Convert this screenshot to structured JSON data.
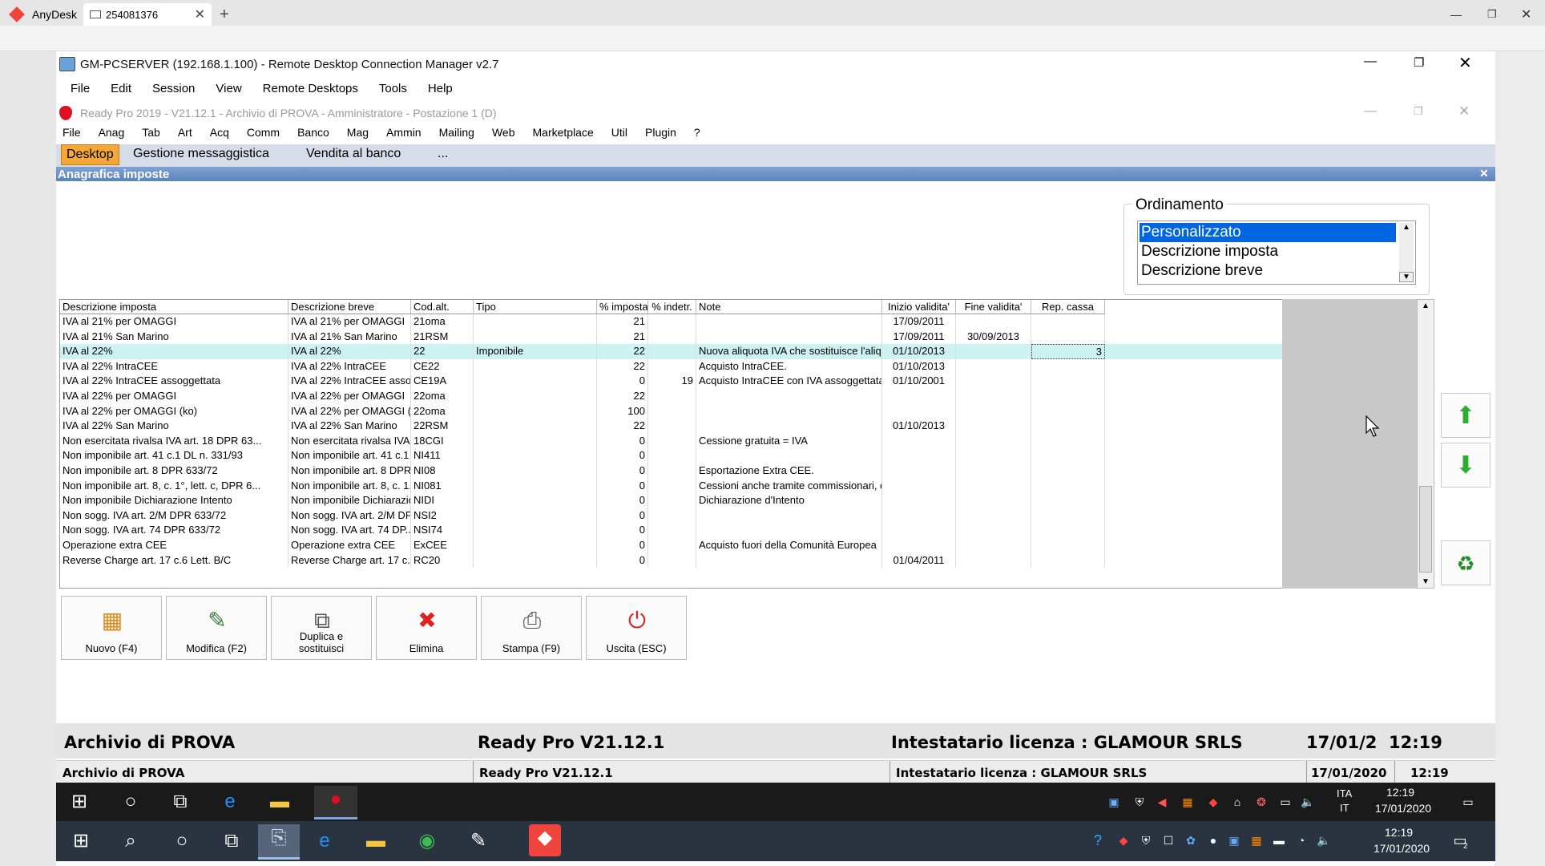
{
  "anydesk": {
    "app_name": "AnyDesk",
    "tab_label": "254081376",
    "address": "254081376",
    "colors": {
      "accent": "#ef443b"
    }
  },
  "rdcm": {
    "title": "GM-PCSERVER (192.168.1.100) - Remote Desktop Connection Manager v2.7",
    "menu": [
      "File",
      "Edit",
      "Session",
      "View",
      "Remote Desktops",
      "Tools",
      "Help"
    ]
  },
  "readypro": {
    "title": "Ready Pro 2019 - V21.12.1 - Archivio di PROVA - Amministratore - Postazione 1 (D)",
    "menu": [
      "File",
      "Anag",
      "Tab",
      "Art",
      "Acq",
      "Comm",
      "Banco",
      "Mag",
      "Ammin",
      "Mailing",
      "Web",
      "Marketplace",
      "Util",
      "Plugin",
      "?"
    ],
    "tabs": [
      "Desktop",
      "Gestione messaggistica",
      "Vendita al banco",
      "..."
    ],
    "panel_title": "Anagrafica imposte"
  },
  "ordinamento": {
    "label": "Ordinamento",
    "options": [
      "Personalizzato",
      "Descrizione imposta",
      "Descrizione breve"
    ],
    "selected": "Personalizzato"
  },
  "grid": {
    "columns": [
      "Descrizione imposta",
      "Descrizione breve",
      "Cod.alt.",
      "Tipo",
      "% imposta",
      "% indetr.",
      "Note",
      "Inizio validita'",
      "Fine validita'",
      "Rep. cassa"
    ],
    "rows": [
      [
        "IVA al 21% per OMAGGI",
        "IVA al 21% per OMAGGI",
        "21oma",
        "",
        "21",
        "",
        "",
        "17/09/2011",
        "",
        ""
      ],
      [
        "IVA al 21% San Marino",
        "IVA al 21% San Marino",
        "21RSM",
        "",
        "21",
        "",
        "",
        "17/09/2011",
        "30/09/2013",
        ""
      ],
      [
        "IVA al 22%",
        "IVA al 22%",
        "22",
        "Imponibile",
        "22",
        "",
        "Nuova aliquota IVA che sostituisce l'aliqu...",
        "01/10/2013",
        "",
        "3"
      ],
      [
        "IVA al 22% IntraCEE",
        "IVA al 22% IntraCEE",
        "CE22",
        "",
        "22",
        "",
        "Acquisto IntraCEE.",
        "01/10/2013",
        "",
        ""
      ],
      [
        "IVA al 22% IntraCEE assoggettata",
        "IVA al 22% IntraCEE asso...",
        "CE19A",
        "",
        "0",
        "19",
        "Acquisto IntraCEE con IVA assoggettata ...",
        "01/10/2001",
        "",
        ""
      ],
      [
        "IVA al 22% per OMAGGI",
        "IVA al 22% per OMAGGI",
        "22oma",
        "",
        "22",
        "",
        "",
        "",
        "",
        ""
      ],
      [
        "IVA al 22% per OMAGGI (ko)",
        "IVA al 22% per OMAGGI (ko)",
        "22oma",
        "",
        "100",
        "",
        "",
        "",
        "",
        ""
      ],
      [
        "IVA al 22% San Marino",
        "IVA al 22% San Marino",
        "22RSM",
        "",
        "22",
        "",
        "",
        "01/10/2013",
        "",
        ""
      ],
      [
        "Non esercitata rivalsa IVA art. 18 DPR 63...",
        "Non esercitata rivalsa IVA ...",
        "18CGI",
        "",
        "0",
        "",
        "Cessione gratuita = IVA",
        "",
        "",
        ""
      ],
      [
        "Non imponibile art. 41 c.1 DL n. 331/93",
        "Non imponibile art. 41 c.1 ...",
        "NI411",
        "",
        "0",
        "",
        "",
        "",
        "",
        ""
      ],
      [
        "Non imponibile art. 8 DPR 633/72",
        "Non imponibile art. 8 DPR ...",
        "NI08",
        "",
        "0",
        "",
        "Esportazione Extra CEE.",
        "",
        "",
        ""
      ],
      [
        "Non imponibile art. 8, c. 1°, lett. c, DPR 6...",
        "Non imponibile art. 8, c. 1...",
        "NI081",
        "",
        "0",
        "",
        "Cessioni anche tramite commissionari, di ...",
        "",
        "",
        ""
      ],
      [
        "Non imponibile Dichiarazione Intento",
        "Non imponibile Dichiarazio...",
        "NIDI",
        "",
        "0",
        "",
        "Dichiarazione d'Intento",
        "",
        "",
        ""
      ],
      [
        "Non sogg. IVA art. 2/M DPR 633/72",
        "Non sogg. IVA art. 2/M DP...",
        "NSI2",
        "",
        "0",
        "",
        "",
        "",
        "",
        ""
      ],
      [
        "Non sogg. IVA art. 74 DPR 633/72",
        "Non sogg. IVA art. 74 DP...",
        "NSI74",
        "",
        "0",
        "",
        "",
        "",
        "",
        ""
      ],
      [
        "Operazione extra CEE",
        "Operazione extra CEE",
        "ExCEE",
        "",
        "0",
        "",
        "Acquisto fuori della Comunità Europea",
        "",
        "",
        ""
      ],
      [
        "Reverse Charge art. 17 c.6 Lett. B/C",
        "Reverse Charge art. 17 c....",
        "RC20",
        "",
        "0",
        "",
        "",
        "01/04/2011",
        "",
        ""
      ]
    ],
    "selected_index": 2
  },
  "buttons": [
    {
      "label": "Nuovo (F4)",
      "icon": "new-grid-icon"
    },
    {
      "label": "Modifica (F2)",
      "icon": "edit-pencil-icon"
    },
    {
      "label": "Duplica e sostituisci",
      "icon": "duplicate-icon"
    },
    {
      "label": "Elimina",
      "icon": "delete-x-icon"
    },
    {
      "label": "Stampa (F9)",
      "icon": "printer-icon"
    },
    {
      "label": "Uscita (ESC)",
      "icon": "exit-power-icon"
    }
  ],
  "statusbar_big": {
    "archive": "Archivio di PROVA",
    "version": "Ready Pro V21.12.1",
    "license": "Intestatario licenza : GLAMOUR SRLS",
    "datetime": "17/01/2  12:19"
  },
  "statusbar_small": {
    "archive": "Archivio di PROVA",
    "version": "Ready Pro V21.12.1",
    "license": "Intestatario licenza : GLAMOUR SRLS",
    "date": "17/01/2020",
    "time": "12:19"
  },
  "remote_taskbar": {
    "lang": "ITA",
    "lang2": "IT",
    "time": "12:19",
    "date": "17/01/2020"
  },
  "local_taskbar": {
    "time": "12:19",
    "date": "17/01/2020",
    "notif_count": "2"
  }
}
